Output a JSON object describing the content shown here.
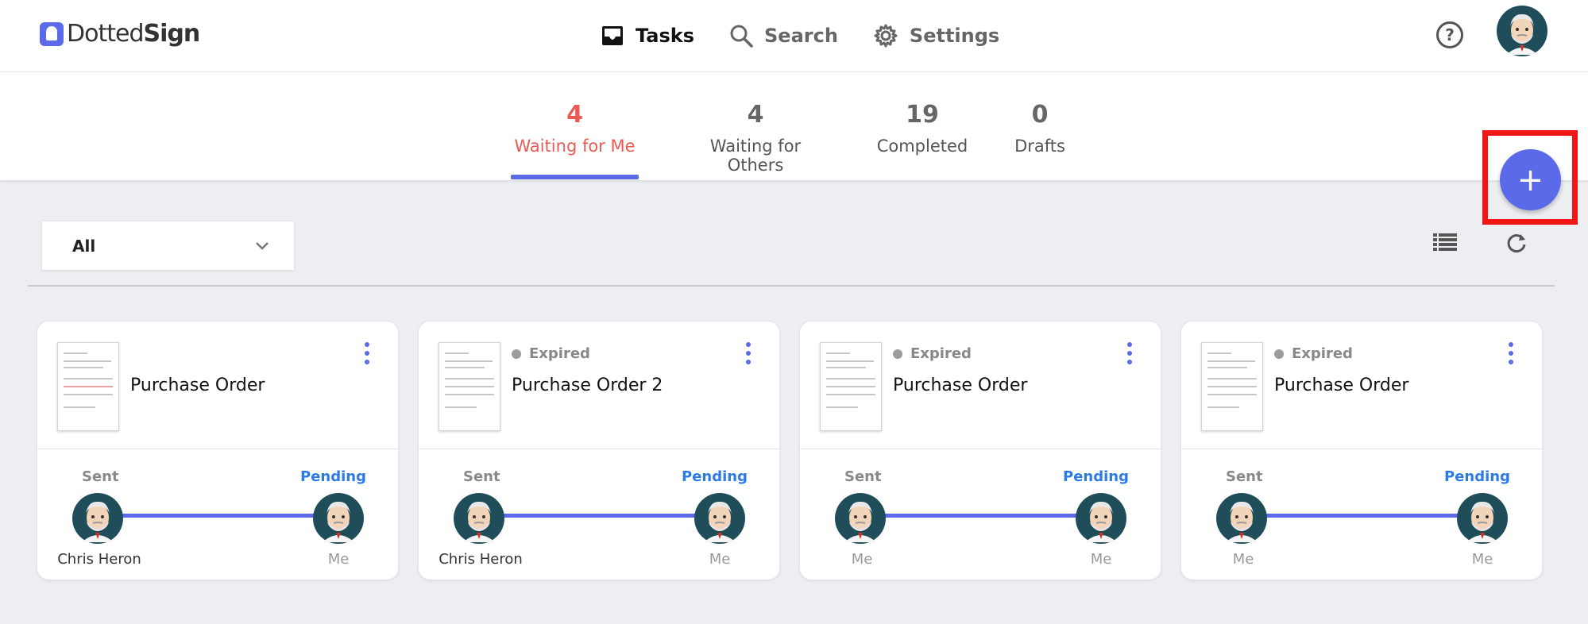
{
  "app": {
    "logo_part1": "Dotted",
    "logo_part2": "Sign"
  },
  "nav": {
    "items": [
      {
        "label": "Tasks",
        "icon": "inbox-icon",
        "active": true
      },
      {
        "label": "Search",
        "icon": "search-icon",
        "active": false
      },
      {
        "label": "Settings",
        "icon": "gear-icon",
        "active": false
      }
    ],
    "help_glyph": "?"
  },
  "tabs": [
    {
      "count": "4",
      "label": "Waiting for Me",
      "active": true
    },
    {
      "count": "4",
      "label": "Waiting for Others",
      "active": false
    },
    {
      "count": "19",
      "label": "Completed",
      "active": false
    },
    {
      "count": "0",
      "label": "Drafts",
      "active": false
    }
  ],
  "fab": {
    "glyph": "+"
  },
  "filter": {
    "selected": "All"
  },
  "colors": {
    "accent": "#5a6ae8",
    "active_tab": "#ea5b55",
    "pending": "#2c7be5",
    "highlight": "#f21515"
  },
  "cards": [
    {
      "status": "",
      "title": "Purchase Order",
      "sent_label": "Sent",
      "pending_label": "Pending",
      "from": "Chris Heron",
      "to": "Me"
    },
    {
      "status": "Expired",
      "title": "Purchase Order 2",
      "sent_label": "Sent",
      "pending_label": "Pending",
      "from": "Chris Heron",
      "to": "Me"
    },
    {
      "status": "Expired",
      "title": "Purchase Order",
      "sent_label": "Sent",
      "pending_label": "Pending",
      "from": "Me",
      "to": "Me"
    },
    {
      "status": "Expired",
      "title": "Purchase Order",
      "sent_label": "Sent",
      "pending_label": "Pending",
      "from": "Me",
      "to": "Me"
    }
  ]
}
